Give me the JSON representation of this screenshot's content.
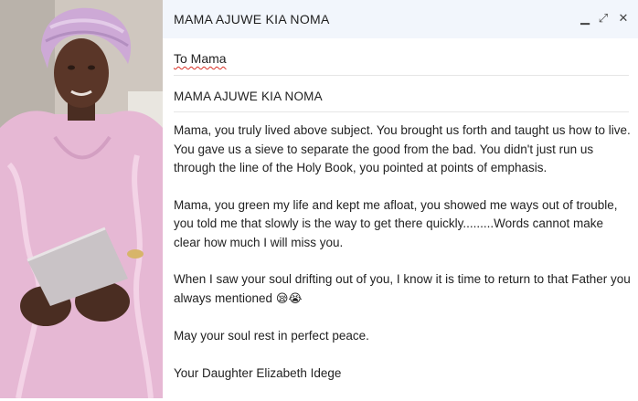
{
  "window": {
    "title": "MAMA AJUWE KIA NOMA",
    "minimize_symbol": "▁",
    "expand_symbol": "⤢",
    "close_symbol": "✕"
  },
  "to": {
    "value": "To Mama"
  },
  "subject": {
    "value": "MAMA AJUWE KIA NOMA"
  },
  "body": {
    "paragraphs": [
      "Mama, you truly lived above subject. You brought us forth and taught us how to live. You gave us a sieve to separate the good from the bad. You didn't just run us through the line of the Holy Book, you pointed at points of emphasis.",
      "Mama, you green my life and kept me afloat, you showed me ways out of trouble, you told me that slowly is the way to get there quickly.........Words cannot make clear how much I will miss you.",
      "When I saw your soul drifting out of you, I know it is time to return to that Father you always mentioned",
      "May your soul rest in perfect peace.",
      "Your Daughter Elizabeth Idege"
    ],
    "emojis": "😪😭"
  },
  "photo": {
    "subject_icon": "portrait-photo"
  },
  "colors": {
    "titlebar_bg": "#f2f6fc",
    "text": "#222222",
    "dress": "#e6b8d4",
    "gele": "#cda9d6"
  }
}
